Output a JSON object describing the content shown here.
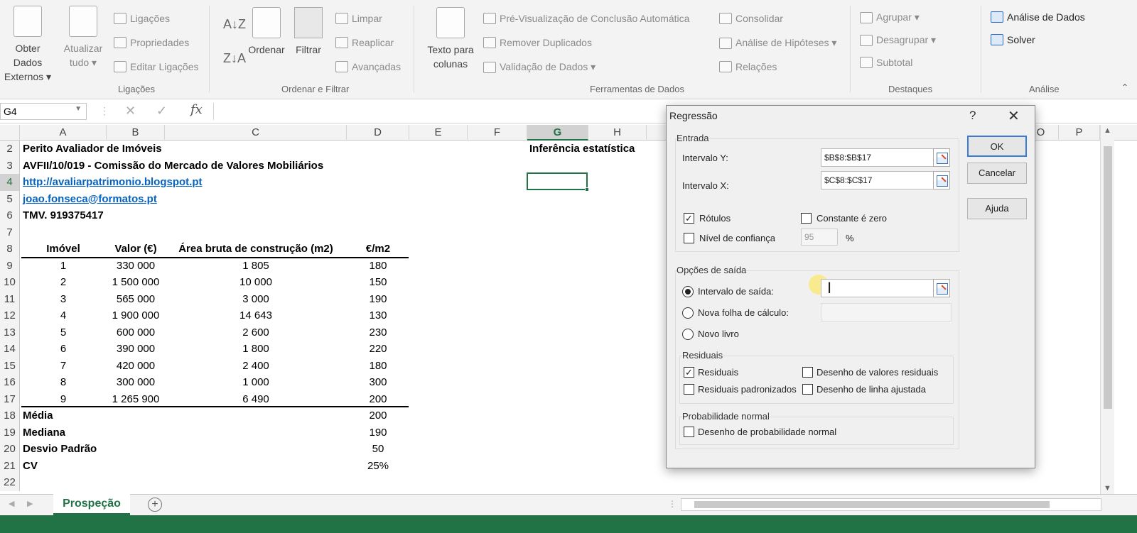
{
  "ribbon": {
    "get_data_line1": "Obter Dados",
    "get_data_line2": "Externos ▾",
    "refresh_line1": "Atualizar",
    "refresh_line2": "tudo ▾",
    "connections_items": [
      "Ligações",
      "Propriedades",
      "Editar Ligações"
    ],
    "connections_group": "Ligações",
    "sort_label": "Ordenar",
    "filter_label": "Filtrar",
    "filter_items": [
      "Limpar",
      "Reaplicar",
      "Avançadas"
    ],
    "sort_filter_group": "Ordenar e Filtrar",
    "text_to_columns_line1": "Texto para",
    "text_to_columns_line2": "colunas",
    "data_tools_items": [
      "Pré-Visualização de Conclusão Automática",
      "Remover Duplicados",
      "Validação de Dados ▾"
    ],
    "data_tools_items2": [
      "Consolidar",
      "Análise de Hipóteses ▾",
      "Relações"
    ],
    "data_tools_group": "Ferramentas de Dados",
    "outline_items": [
      "Agrupar ▾",
      "Desagrupar ▾",
      "Subtotal"
    ],
    "outline_group": "Destaques",
    "analysis_items": [
      "Análise de Dados",
      "Solver"
    ],
    "analysis_group": "Análise"
  },
  "formula_bar": {
    "name_box": "G4",
    "fx": "fx",
    "cancel": "✕",
    "enter": "✓"
  },
  "columns": [
    "A",
    "B",
    "C",
    "D",
    "E",
    "F",
    "G",
    "H",
    "O",
    "P"
  ],
  "rows": [
    {
      "n": "2",
      "a": "Perito Avaliador de Imóveis",
      "g": "Inferência estatística"
    },
    {
      "n": "3",
      "a": "AVFII/10/019 -  Comissão do Mercado de Valores Mobiliários"
    },
    {
      "n": "4",
      "a": "http://avaliarpatrimonio.blogspot.pt"
    },
    {
      "n": "5",
      "a": "joao.fonseca@formatos.pt"
    },
    {
      "n": "6",
      "a": "TMV. 919375417"
    },
    {
      "n": "7"
    },
    {
      "n": "8",
      "a": "Imóvel",
      "b": "Valor (€)",
      "c": "Área bruta de construção (m2)",
      "d": "€/m2"
    },
    {
      "n": "9",
      "a": "1",
      "b": "330 000",
      "c": "1 805",
      "d": "180"
    },
    {
      "n": "10",
      "a": "2",
      "b": "1 500 000",
      "c": "10 000",
      "d": "150"
    },
    {
      "n": "11",
      "a": "3",
      "b": "565 000",
      "c": "3 000",
      "d": "190"
    },
    {
      "n": "12",
      "a": "4",
      "b": "1 900 000",
      "c": "14 643",
      "d": "130"
    },
    {
      "n": "13",
      "a": "5",
      "b": "600 000",
      "c": "2 600",
      "d": "230"
    },
    {
      "n": "14",
      "a": "6",
      "b": "390 000",
      "c": "1 800",
      "d": "220"
    },
    {
      "n": "15",
      "a": "7",
      "b": "420 000",
      "c": "2 400",
      "d": "180"
    },
    {
      "n": "16",
      "a": "8",
      "b": "300 000",
      "c": "1 000",
      "d": "300"
    },
    {
      "n": "17",
      "a": "9",
      "b": "1 265 900",
      "c": "6 490",
      "d": "200"
    },
    {
      "n": "18",
      "a": "Média",
      "d": "200"
    },
    {
      "n": "19",
      "a": "Mediana",
      "d": "190"
    },
    {
      "n": "20",
      "a": "Desvio Padrão",
      "d": "50"
    },
    {
      "n": "21",
      "a": "CV",
      "d": "25%"
    },
    {
      "n": "22"
    }
  ],
  "sheet_tab": "Prospeção",
  "add_sheet": "+",
  "dialog": {
    "title": "Regressão",
    "help": "?",
    "close": "✕",
    "input_legend": "Entrada",
    "y_range_label": "Intervalo Y:",
    "y_range_value": "$B$8:$B$17",
    "x_range_label": "Intervalo X:",
    "x_range_value": "$C$8:$C$17",
    "labels_label": "Rótulos",
    "constant_zero_label": "Constante é zero",
    "confidence_label": "Nível de confiança",
    "confidence_value": "95",
    "percent": "%",
    "output_legend": "Opções de saída",
    "output_range_label": "Intervalo de saída:",
    "new_sheet_label": "Nova folha de cálculo:",
    "new_workbook_label": "Novo livro",
    "residuals_legend": "Residuais",
    "residuals_label": "Residuais",
    "residual_plots_label": "Desenho de valores residuais",
    "std_residuals_label": "Residuais padronizados",
    "line_fit_label": "Desenho de linha ajustada",
    "normal_prob_legend": "Probabilidade normal",
    "normal_plot_label": "Desenho de probabilidade normal",
    "ok": "OK",
    "cancel": "Cancelar",
    "help_button": "Ajuda",
    "check_mark": "✓"
  }
}
